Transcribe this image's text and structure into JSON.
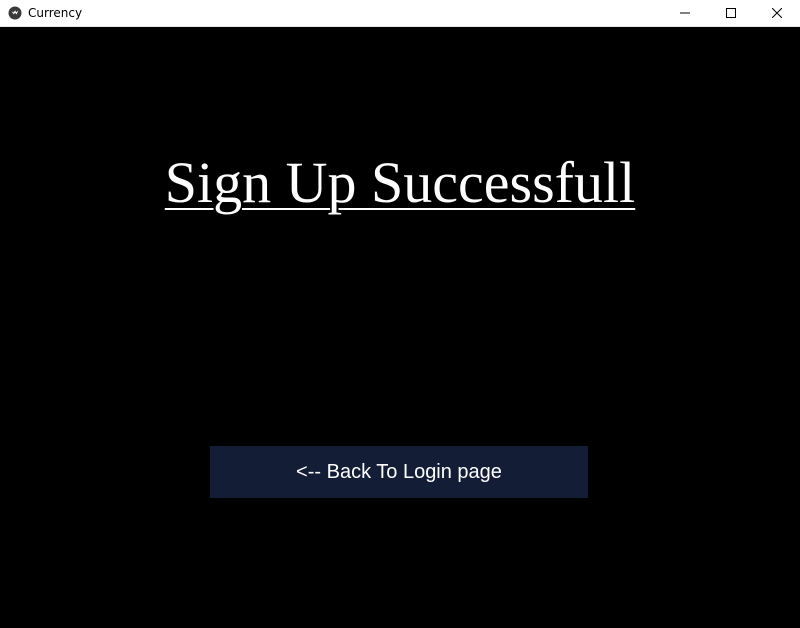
{
  "window": {
    "title": "Currency",
    "app_icon": "kivy-logo-icon",
    "controls": [
      "minimize-icon",
      "maximize-icon",
      "close-icon"
    ]
  },
  "main": {
    "heading": "Sign Up Successfull",
    "back_button_label": "<-- Back To Login page"
  },
  "colors": {
    "background": "#000000",
    "titlebar": "#ffffff",
    "heading_text": "#ffffff",
    "button_background": "#131d35",
    "button_text": "#ffffff"
  }
}
